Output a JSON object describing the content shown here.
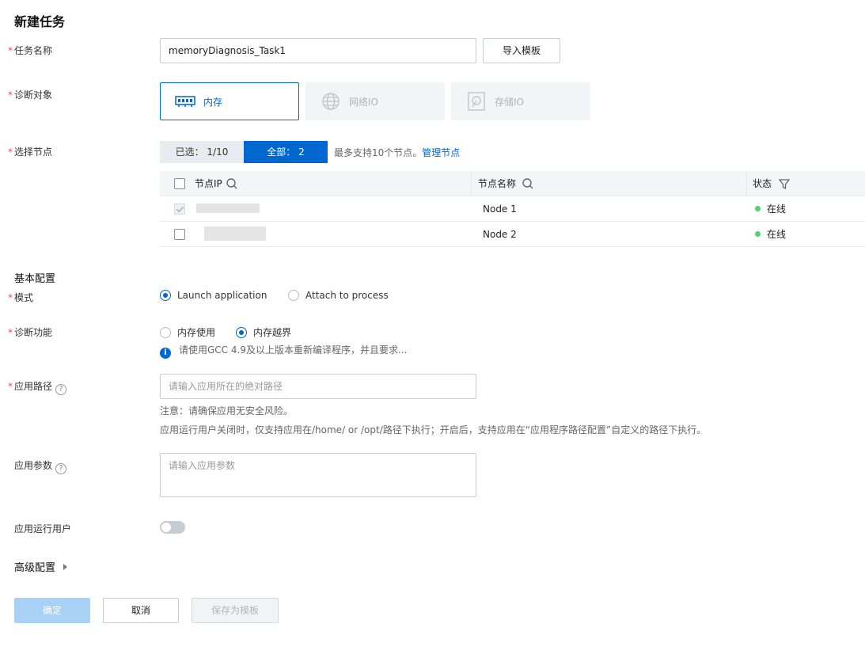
{
  "title": "新建任务",
  "task_name": {
    "label": "任务名称",
    "value": "memoryDiagnosis_Task1",
    "import_button": "导入模板"
  },
  "target": {
    "label": "诊断对象",
    "options": [
      {
        "label": "内存",
        "icon": "memory-chip-icon",
        "state": "selected"
      },
      {
        "label": "网络IO",
        "icon": "globe-icon",
        "state": "disabled"
      },
      {
        "label": "存储IO",
        "icon": "disk-icon",
        "state": "disabled"
      }
    ]
  },
  "nodes": {
    "label": "选择节点",
    "selected_tab": "已选：  1/10",
    "all_tab": "全部：  2",
    "hint": "最多支持10个节点。",
    "manage_link": "管理节点",
    "columns": {
      "ip": "节点IP",
      "name": "节点名称",
      "status": "状态"
    },
    "rows": [
      {
        "name": "Node 1",
        "status": "在线",
        "checked": true,
        "disabled": true
      },
      {
        "name": "Node 2",
        "status": "在线",
        "checked": false,
        "disabled": false
      }
    ],
    "status_color": "#5cc973"
  },
  "basic_config": {
    "section": "基本配置",
    "mode": {
      "label": "模式",
      "options": [
        "Launch application",
        "Attach to process"
      ],
      "selected": "Launch application"
    },
    "function": {
      "label": "诊断功能",
      "options": [
        "内存使用",
        "内存越界"
      ],
      "selected": "内存越界",
      "info": "请使用GCC 4.9及以上版本重新编译程序，并且要求..."
    },
    "app_path": {
      "label": "应用路径",
      "placeholder": "请输入应用所在的绝对路径",
      "note1": "注意：请确保应用无安全风险。",
      "note2": "应用运行用户关闭时，仅支持应用在/home/ or /opt/路径下执行；开启后，支持应用在“应用程序路径配置”自定义的路径下执行。"
    },
    "app_params": {
      "label": "应用参数",
      "placeholder": "请输入应用参数"
    },
    "run_user": {
      "label": "应用运行用户",
      "enabled": false
    }
  },
  "advanced": {
    "label": "高级配置"
  },
  "actions": {
    "ok": "确定",
    "cancel": "取消",
    "save_template": "保存为模板"
  },
  "colors": {
    "primary": "#0067d1",
    "required": "#e34d59"
  }
}
